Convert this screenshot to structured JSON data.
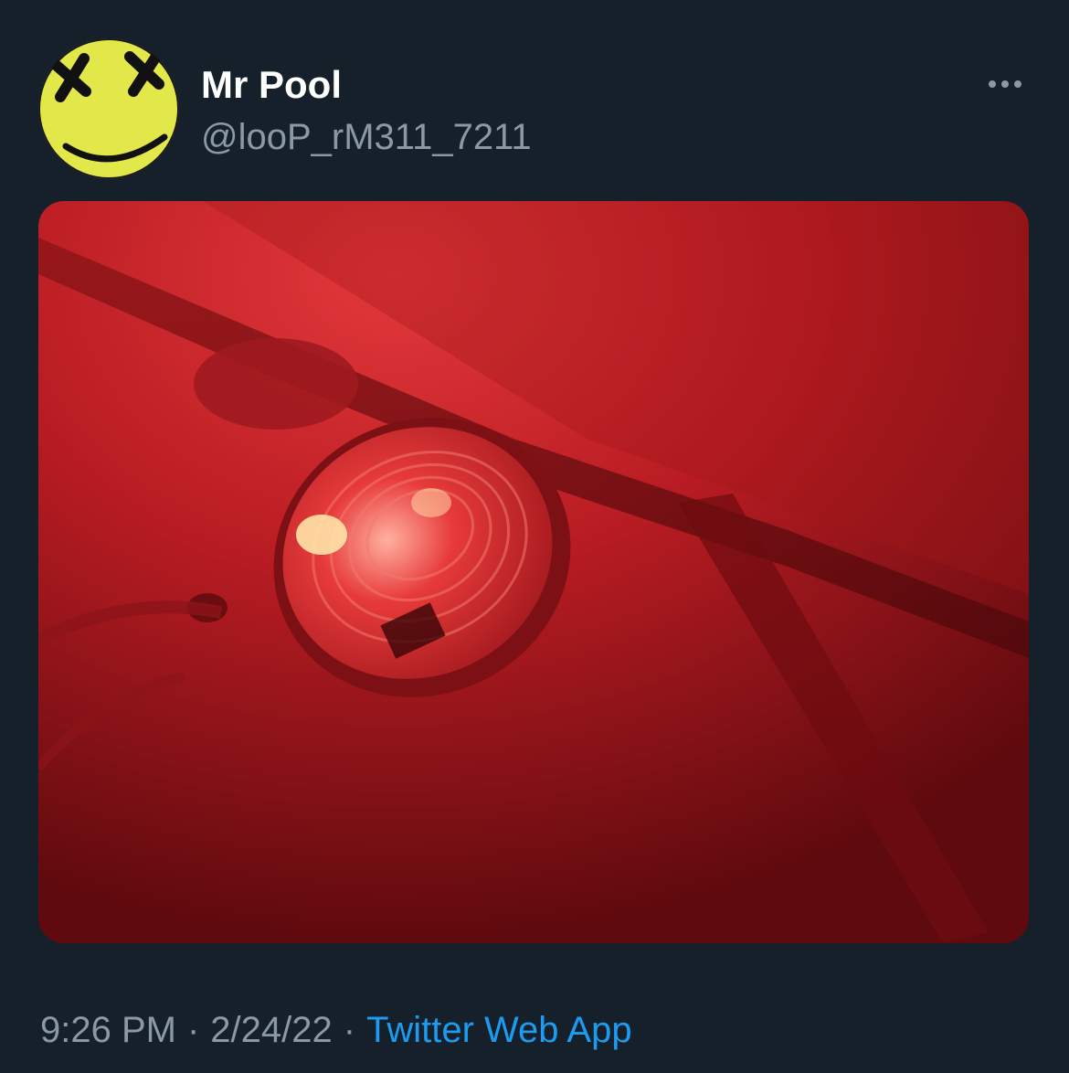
{
  "tweet": {
    "author": {
      "display_name": "Mr Pool",
      "handle": "@looP_rM311_7211"
    },
    "more_icon": "more-horizontal-icon",
    "media": {
      "type": "photo",
      "avatar_color": "#e8ec4a"
    },
    "time": "9:26 PM",
    "date": "2/24/22",
    "separator": "·",
    "source": "Twitter Web App"
  },
  "theme": {
    "background": "#15202b",
    "primary_text": "#ffffff",
    "secondary_text": "#8b98a5",
    "link": "#1d9bf0"
  }
}
